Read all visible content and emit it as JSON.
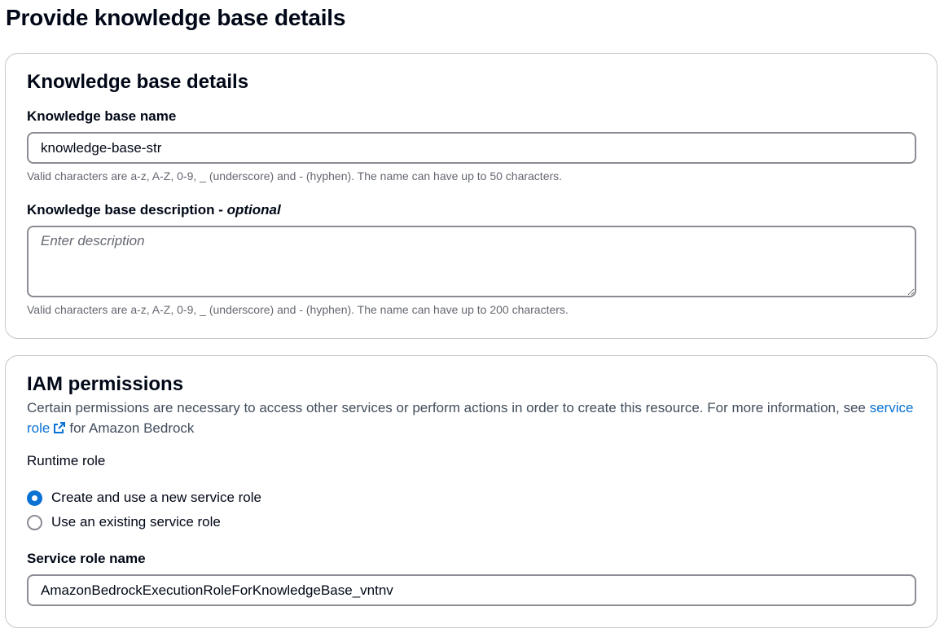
{
  "page": {
    "title": "Provide knowledge base details"
  },
  "kb_details": {
    "title": "Knowledge base details",
    "name_label": "Knowledge base name",
    "name_value": "knowledge-base-str",
    "name_constraint": "Valid characters are a-z, A-Z, 0-9, _ (underscore) and - (hyphen). The name can have up to 50 characters.",
    "description_label": "Knowledge base description - ",
    "description_optional": "optional",
    "description_placeholder": "Enter description",
    "description_value": "",
    "description_constraint": "Valid characters are a-z, A-Z, 0-9, _ (underscore) and - (hyphen). The name can have up to 200 characters."
  },
  "iam": {
    "title": "IAM permissions",
    "description_pre": "Certain permissions are necessary to access other services or perform actions in order to create this resource. For more information, see ",
    "link_text": "service role",
    "description_post": "for Amazon Bedrock",
    "link_icon": "external-link-icon",
    "runtime_role_label": "Runtime role",
    "options": [
      {
        "label": "Create and use a new service role",
        "selected": true
      },
      {
        "label": "Use an existing service role",
        "selected": false
      }
    ],
    "service_role_name_label": "Service role name",
    "service_role_name_value": "AmazonBedrockExecutionRoleForKnowledgeBase_vntnv"
  },
  "colors": {
    "accent": "#0972d3",
    "text": "#000716",
    "secondary_text": "#656871",
    "border": "#8c8c94",
    "card_border": "#c6c6cd"
  }
}
